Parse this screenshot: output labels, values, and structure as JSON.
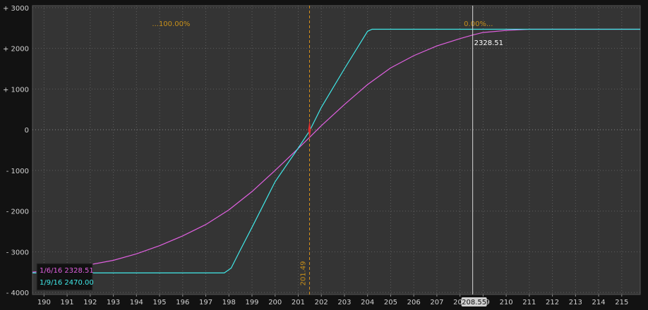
{
  "colors": {
    "background": "#121212",
    "plot_bg": "#343434",
    "grid": "#5e5e5e",
    "axis_text": "#d2d2d2",
    "series1": "#e060e0",
    "series2": "#40e8e8",
    "marker_line": "#d8901a",
    "prob_text": "#c8901a",
    "cursor_line": "#d8d8d8",
    "cursor_text": "#ffffff"
  },
  "chart_data": {
    "type": "line",
    "title": "",
    "xlabel": "",
    "ylabel": "",
    "xlim": [
      189.5,
      215.8
    ],
    "ylim": [
      -4050,
      3050
    ],
    "x_ticks": [
      "190",
      "191",
      "192",
      "193",
      "194",
      "195",
      "196",
      "197",
      "198",
      "199",
      "200",
      "201",
      "202",
      "203",
      "204",
      "205",
      "206",
      "207",
      "208",
      "209",
      "210",
      "211",
      "212",
      "213",
      "214",
      "215"
    ],
    "y_ticks": [
      {
        "value": 3000,
        "label": "+ 3000"
      },
      {
        "value": 2000,
        "label": "+ 2000"
      },
      {
        "value": 1000,
        "label": "+ 1000"
      },
      {
        "value": 0,
        "label": "0"
      },
      {
        "value": -1000,
        "label": "- 1000"
      },
      {
        "value": -2000,
        "label": "- 2000"
      },
      {
        "value": -3000,
        "label": "- 3000"
      },
      {
        "value": -4000,
        "label": "- 4000"
      }
    ],
    "grid": true,
    "series": [
      {
        "name": "1/6/16",
        "color": "#e060e0",
        "readout": "2328.51",
        "x": [
          189.5,
          191,
          193,
          194,
          195,
          196,
          197,
          198,
          199,
          200,
          201,
          201.49,
          202,
          203,
          204,
          205,
          206,
          207,
          208,
          208.55,
          209,
          210,
          211,
          215.8
        ],
        "y": [
          -3500,
          -3420,
          -3210,
          -3050,
          -2850,
          -2610,
          -2330,
          -1970,
          -1520,
          -1000,
          -460,
          -190,
          100,
          620,
          1110,
          1520,
          1820,
          2060,
          2240,
          2328.51,
          2390,
          2440,
          2470,
          2470
        ]
      },
      {
        "name": "1/9/16",
        "color": "#40e8e8",
        "readout": "2470.00",
        "x": [
          189.5,
          197.8,
          198.1,
          198.5,
          199,
          200,
          201,
          201.49,
          202,
          203,
          204,
          204.2,
          215.8
        ],
        "y": [
          -3520,
          -3520,
          -3400,
          -2950,
          -2400,
          -1280,
          -450,
          -30,
          550,
          1500,
          2420,
          2470,
          2470
        ]
      }
    ],
    "marker": {
      "x": 201.49,
      "label": "201.49"
    },
    "cursor": {
      "x": 208.55,
      "label": "208.55",
      "value_label": "2328.51"
    },
    "probabilities": [
      {
        "label": "...100.00%",
        "x": 195.5
      },
      {
        "label": "0.00%...",
        "x": 208.8
      }
    ],
    "legend": "bottom-left"
  }
}
